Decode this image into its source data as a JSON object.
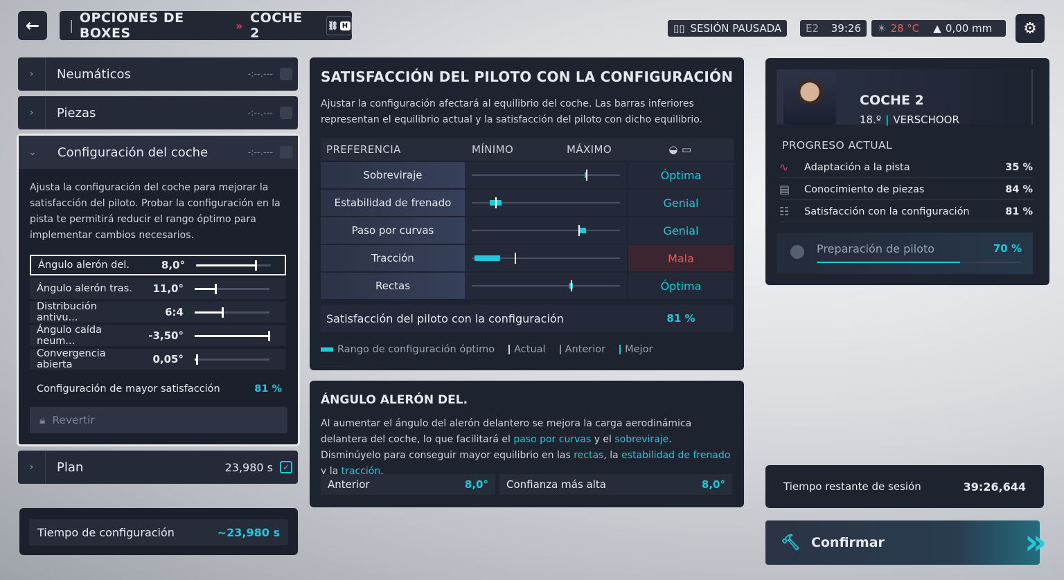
{
  "header": {
    "title": "OPCIONES DE BOXES",
    "sep": "»",
    "car": "COCHE 2",
    "lock_key": "H"
  },
  "status": {
    "paused": "SESIÓN PAUSADA",
    "sector": "E2",
    "time": "39:26",
    "temp": "28 °C",
    "rain": "0,00 mm"
  },
  "accordion": {
    "tyres": {
      "label": "Neumáticos",
      "val": "-:--.---"
    },
    "parts": {
      "label": "Piezas",
      "val": "-:--.---"
    },
    "setup": {
      "label": "Configuración del coche",
      "val": "-:--.---",
      "desc": "Ajusta la configuración del coche para mejorar la satisfacción del piloto. Probar la configuración en la pista te permitirá reducir el rango óptimo para implementar cambios necesarios.",
      "rows": [
        {
          "name": "Ángulo alerón del.",
          "value": "8,0°",
          "pct": 0.81
        },
        {
          "name": "Ángulo alerón tras.",
          "value": "11,0°",
          "pct": 0.29
        },
        {
          "name": "Distribución antivu...",
          "value": "6:4",
          "pct": 0.38
        },
        {
          "name": "Ángulo caída neum...",
          "value": "-3,50°",
          "pct": 1.0
        },
        {
          "name": "Convergencia abierta",
          "value": "0,05°",
          "pct": 0.04
        }
      ],
      "best_label": "Configuración de mayor satisfacción",
      "best_value": "81 %",
      "revert": "Revertir"
    },
    "plan": {
      "label": "Plan",
      "val": "23,980 s"
    }
  },
  "setup_time": {
    "label": "Tiempo de configuración",
    "value": "~23,980 s"
  },
  "satisfaction": {
    "title": "SATISFACCIÓN DEL PILOTO CON LA CONFIGURACIÓN",
    "desc": "Ajustar la configuración afectará al equilibrio del coche. Las barras inferiores representan el equilibrio actual y la satisfacción del piloto con dicho equilibrio.",
    "headers": {
      "pref": "PREFERENCIA",
      "min": "MÍNIMO",
      "max": "MÁXIMO"
    },
    "rows": [
      {
        "name": "Sobreviraje",
        "rating": "Óptima",
        "bad": false,
        "range": [
          0.76,
          0.78
        ],
        "mark": 0.77
      },
      {
        "name": "Estabilidad de frenado",
        "rating": "Genial",
        "bad": false,
        "range": [
          0.12,
          0.2
        ],
        "mark": 0.16
      },
      {
        "name": "Paso por curvas",
        "rating": "Genial",
        "bad": false,
        "range": [
          0.72,
          0.77
        ],
        "mark": 0.72
      },
      {
        "name": "Tracción",
        "rating": "Mala",
        "bad": true,
        "range": [
          0.02,
          0.19
        ],
        "mark": 0.29
      },
      {
        "name": "Rectas",
        "rating": "Óptima",
        "bad": false,
        "range": [
          0.66,
          0.68
        ],
        "mark": 0.67
      }
    ],
    "summary_label": "Satisfacción del piloto con la configuración",
    "summary_value": "81 %",
    "legend": {
      "range": "Rango de configuración óptimo",
      "current": "Actual",
      "previous": "Anterior",
      "best": "Mejor"
    }
  },
  "wing": {
    "title": "ÁNGULO ALERÓN DEL.",
    "p1": "Al aumentar el ángulo del alerón delantero se mejora la carga aerodinámica delantera del coche, lo que facilitará el ",
    "l1": "paso por curvas",
    "p2": " y el ",
    "l2": "sobreviraje",
    "p3": ". Disminúyelo para conseguir mayor equilibrio en las ",
    "l3": "rectas",
    "p4": ", la ",
    "l4": "estabilidad de frenado",
    "p5": " y la ",
    "l5": "tracción",
    "p6": ".",
    "prev_label": "Anterior",
    "prev_value": "8,0°",
    "best_label": "Confianza más alta",
    "best_value": "8,0°"
  },
  "driver": {
    "car": "COCHE 2",
    "pos": "18.º",
    "name": "VERSCHOOR"
  },
  "progress": {
    "title": "PROGRESO ACTUAL",
    "rows": [
      {
        "name": "Adaptación a la pista",
        "value": "35 %"
      },
      {
        "name": "Conocimiento de piezas",
        "value": "84 %"
      },
      {
        "name": "Satisfacción con la configuración",
        "value": "81 %"
      }
    ],
    "prep_label": "Preparación de piloto",
    "prep_value": "70 %",
    "prep_pct": 0.7
  },
  "remaining": {
    "label": "Tiempo restante de sesión",
    "value": "39:26,644"
  },
  "confirm": {
    "label": "Confirmar"
  },
  "colors": {
    "accent": "#1ec9d8",
    "bad": "#e05a5a",
    "panel": "#1e2330"
  }
}
